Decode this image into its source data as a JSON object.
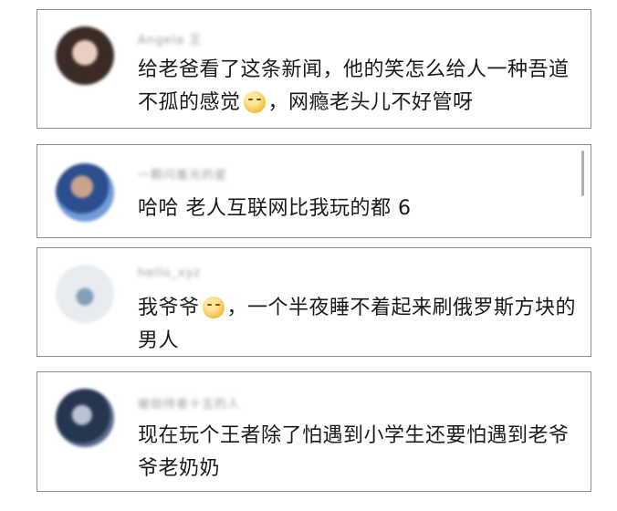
{
  "comments": [
    {
      "username": "Angela 王",
      "text_a": "给老爸看了这条新闻，他的笑怎么给人一种吾道不孤的感觉",
      "emoji": "smirk-emoji",
      "text_b": "，网瘾老头儿不好管呀"
    },
    {
      "username": "一颗闪着光的星",
      "text_a": "哈哈 老人互联网比我玩的都 6"
    },
    {
      "username": "hello_xyz",
      "text_a": "我爷爷",
      "emoji": "grin-emoji",
      "text_b": "，一个半夜睡不着起来刷俄罗斯方块的男人"
    },
    {
      "username": "被劫持者十五的人",
      "text_a": "现在玩个王者除了怕遇到小学生还要怕遇到老爷爷老奶奶"
    }
  ]
}
